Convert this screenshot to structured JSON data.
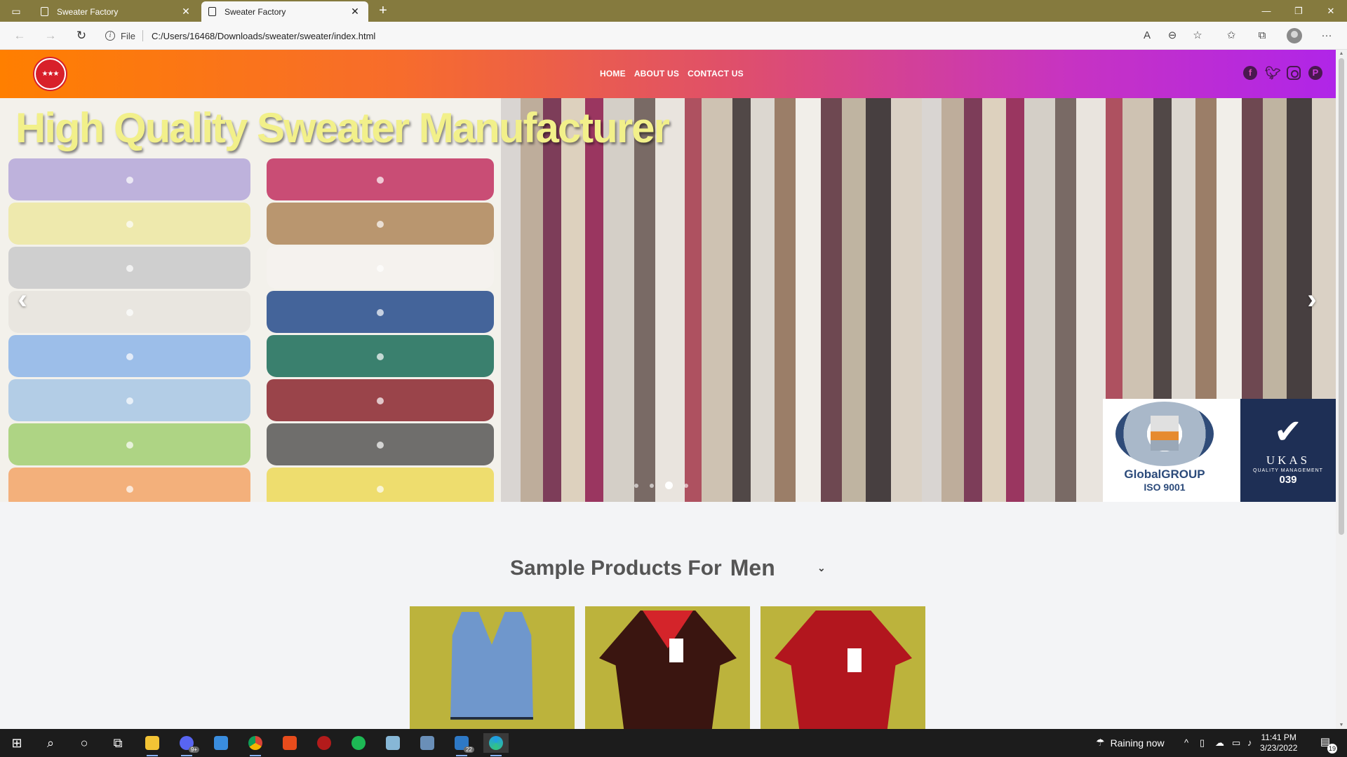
{
  "browser": {
    "tabs": [
      {
        "title": "Sweater Factory",
        "active": false
      },
      {
        "title": "Sweater Factory",
        "active": true
      }
    ],
    "url_scheme": "File",
    "url": "C:/Users/16468/Downloads/sweater/sweater/index.html"
  },
  "site": {
    "nav": [
      "HOME",
      "ABOUT US",
      "CONTACT US"
    ],
    "social_icons": [
      "facebook-icon",
      "twitter-icon",
      "instagram-icon",
      "pinterest-icon"
    ],
    "header_gradient": [
      "#ff7f00",
      "#b025e8"
    ]
  },
  "hero": {
    "title": "High Quality Sweater Manufacturer",
    "cert_global_brand": "GlobalGROUP",
    "cert_global_std": "ISO 9001",
    "cert_ukas_name": "UKAS",
    "cert_ukas_sub": "QUALITY MANAGEMENT",
    "cert_ukas_num": "039",
    "slide_count": 4,
    "active_slide": 3
  },
  "products": {
    "heading": "Sample Products For",
    "category": "Men",
    "card_color": "#bcb33c",
    "items": [
      "vest",
      "v-neck-jumper",
      "zip-cardigan"
    ]
  },
  "taskbar": {
    "weather": "Raining now",
    "time": "11:41 PM",
    "date": "3/23/2022",
    "mail_badge": "22",
    "discord_badge": "9+",
    "notifications": "19"
  }
}
